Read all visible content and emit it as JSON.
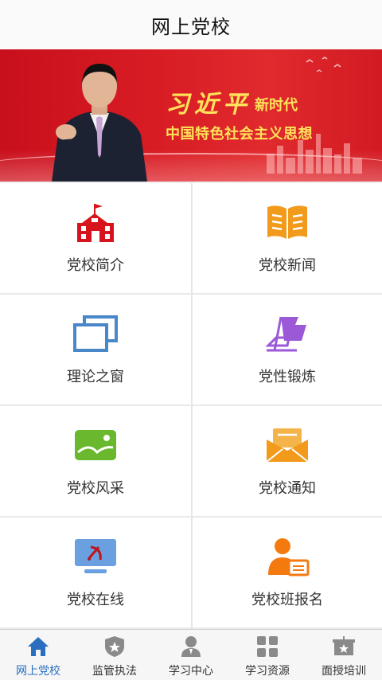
{
  "header": {
    "title": "网上党校"
  },
  "banner": {
    "name_text": "习近平",
    "line1_suffix": "新时代",
    "line2": "中国特色社会主义思想"
  },
  "grid": [
    {
      "label": "党校简介",
      "icon": "school-building-icon"
    },
    {
      "label": "党校新闻",
      "icon": "open-book-icon"
    },
    {
      "label": "理论之窗",
      "icon": "windows-icon"
    },
    {
      "label": "党性锻炼",
      "icon": "flag-icon"
    },
    {
      "label": "党校风采",
      "icon": "landscape-photo-icon"
    },
    {
      "label": "党校通知",
      "icon": "envelope-icon"
    },
    {
      "label": "党校在线",
      "icon": "monitor-emblem-icon"
    },
    {
      "label": "党校班报名",
      "icon": "user-card-icon"
    }
  ],
  "tabs": [
    {
      "label": "网上党校",
      "icon": "home-icon",
      "active": true
    },
    {
      "label": "监管执法",
      "icon": "shield-star-icon",
      "active": false
    },
    {
      "label": "学习中心",
      "icon": "user-icon",
      "active": false
    },
    {
      "label": "学习资源",
      "icon": "grid-icon",
      "active": false
    },
    {
      "label": "面授培训",
      "icon": "board-star-icon",
      "active": false
    }
  ],
  "colors": {
    "banner_red": "#d81c24",
    "banner_text": "#ffe35a",
    "active_tab": "#2a6ebf",
    "red_icon": "#d7141c",
    "orange_icon": "#f29a1c",
    "blue_icon": "#4a87c9",
    "purple_icon": "#9b59d8",
    "green_icon": "#6ab82d"
  }
}
